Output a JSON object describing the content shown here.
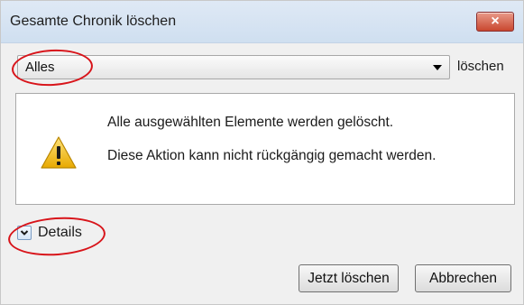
{
  "dialog": {
    "title": "Gesamte Chronik löschen",
    "close_symbol": "×"
  },
  "time_range": {
    "selected": "Alles",
    "suffix": "löschen"
  },
  "message": {
    "icon": "warning-icon",
    "line1": "Alle ausgewählten Elemente werden gelöscht.",
    "line2": "Diese Aktion kann nicht rückgängig gemacht werden."
  },
  "details": {
    "label": "Details",
    "expanded": false
  },
  "buttons": {
    "confirm": "Jetzt löschen",
    "cancel": "Abbrechen"
  },
  "colors": {
    "annotation_red": "#d8141a",
    "close_button": "#c9472f",
    "warning_yellow": "#f2c21a"
  }
}
